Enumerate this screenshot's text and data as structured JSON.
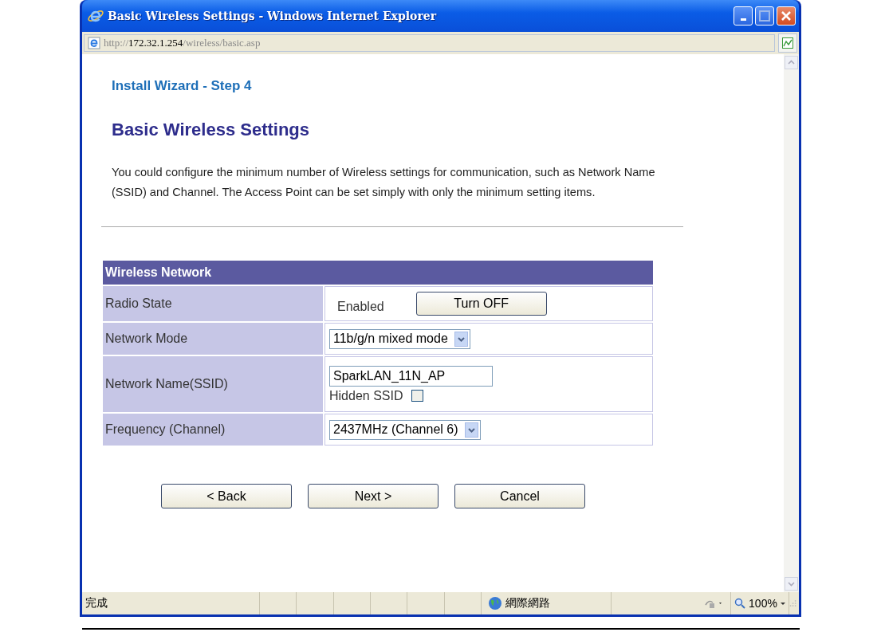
{
  "window": {
    "title": "Basic Wireless Settings - Windows Internet Explorer"
  },
  "address_bar": {
    "scheme": "http://",
    "host": "172.32.1.254",
    "path": "/wireless/basic.asp"
  },
  "page": {
    "wizard_step": "Install Wizard - Step 4",
    "heading": "Basic Wireless Settings",
    "description": "You could configure the minimum number of Wireless settings for communication, such as Network Name (SSID) and Channel. The Access Point can be set simply with only the minimum setting items."
  },
  "table": {
    "title": "Wireless Network",
    "rows": [
      {
        "kind": "status",
        "label": "Radio State",
        "value": "Enabled",
        "button": "Turn OFF"
      },
      {
        "kind": "select",
        "label": "Network Mode",
        "value": "11b/g/n mixed mode"
      },
      {
        "kind": "text_checkbox",
        "label": "Network Name(SSID)",
        "value": "SparkLAN_11N_AP",
        "checkbox_label": "Hidden SSID",
        "checked": false
      },
      {
        "kind": "select",
        "label": "Frequency (Channel)",
        "value": "2437MHz (Channel 6)"
      }
    ]
  },
  "buttons": [
    "< Back",
    "Next >",
    "Cancel"
  ],
  "status_bar": {
    "status": "完成",
    "zone": "網際網路",
    "zoom": "100%"
  }
}
